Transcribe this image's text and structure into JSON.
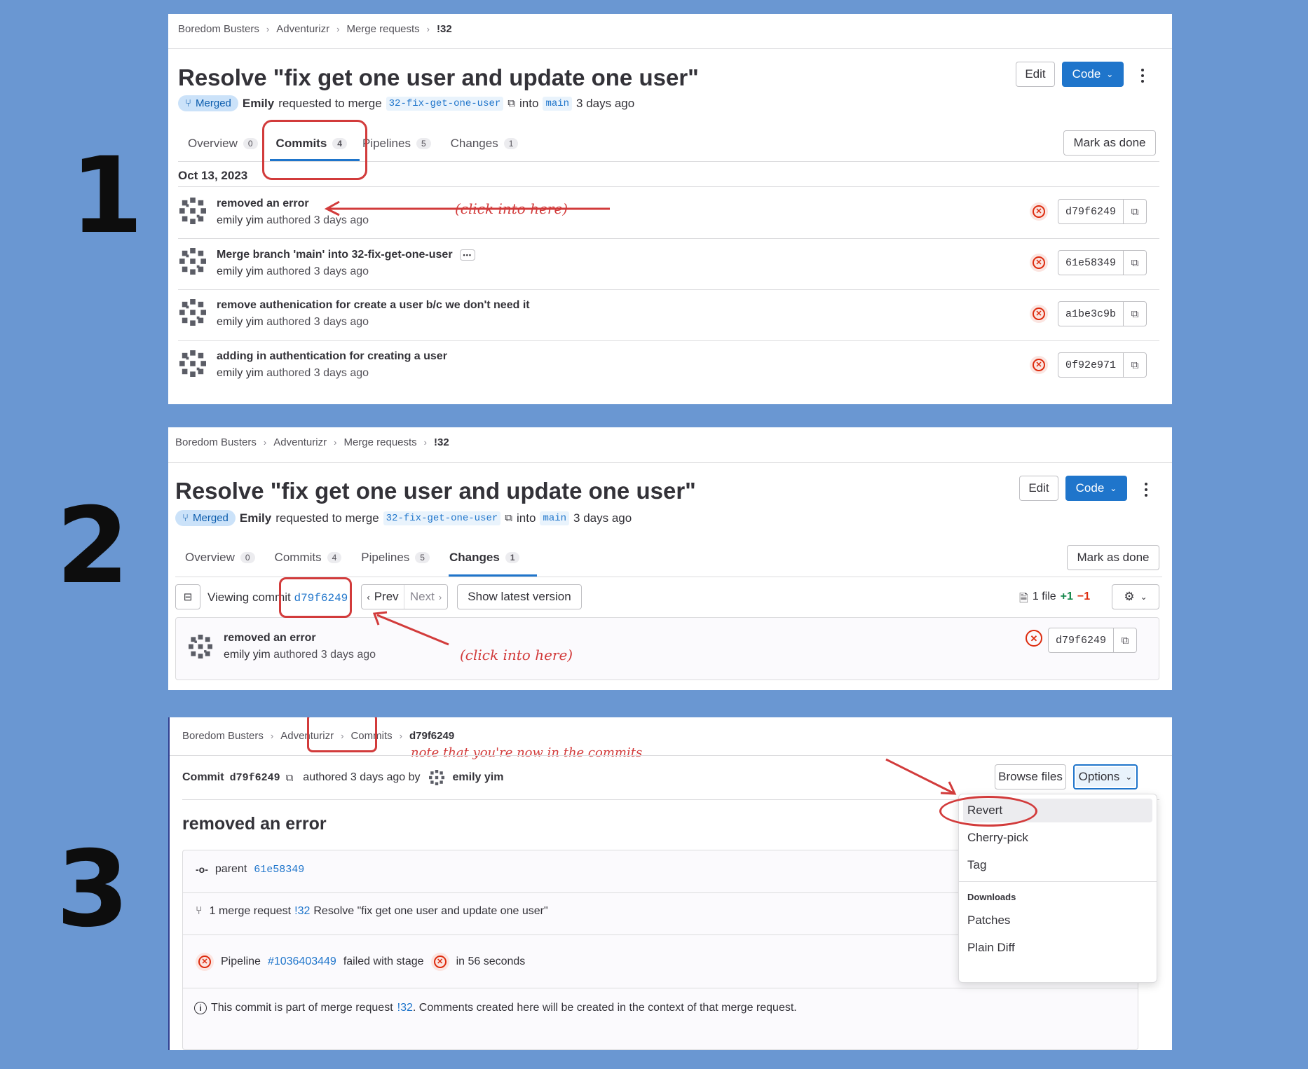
{
  "steps": [
    "1",
    "2",
    "3"
  ],
  "breadcrumb": {
    "group": "Boredom Busters",
    "project": "Adventurizr",
    "section": "Merge requests",
    "mr": "!32"
  },
  "mr": {
    "title": "Resolve \"fix get one user and update one user\"",
    "status": "Merged",
    "author": "Emily",
    "requested_text": "requested to merge",
    "source_branch": "32-fix-get-one-user",
    "into_text": "into",
    "target_branch": "main",
    "time": "3 days ago"
  },
  "buttons": {
    "edit": "Edit",
    "code": "Code",
    "mark_done": "Mark as done"
  },
  "tabs": [
    {
      "label": "Overview",
      "count": "0"
    },
    {
      "label": "Commits",
      "count": "4"
    },
    {
      "label": "Pipelines",
      "count": "5"
    },
    {
      "label": "Changes",
      "count": "1"
    }
  ],
  "commits_date": "Oct 13, 2023",
  "commits": [
    {
      "title": "removed an error",
      "author": "emily yim",
      "meta": "authored 3 days ago",
      "sha": "d79f6249"
    },
    {
      "title": "Merge branch 'main' into 32-fix-get-one-user",
      "author": "emily yim",
      "meta": "authored 3 days ago",
      "sha": "61e58349",
      "ellipsis": "•••"
    },
    {
      "title": "remove authenication for create a user b/c we don't need it",
      "author": "emily yim",
      "meta": "authored 3 days ago",
      "sha": "a1be3c9b"
    },
    {
      "title": "adding in authentication for creating a user",
      "author": "emily yim",
      "meta": "authored 3 days ago",
      "sha": "0f92e971"
    }
  ],
  "annotations": {
    "click_here_1": "(click into here)",
    "click_here_2": "(click into here)",
    "note_commits": "note that you're now in the commits"
  },
  "changes": {
    "viewing_label": "Viewing commit",
    "viewing_sha": "d79f6249",
    "prev": "Prev",
    "next": "Next",
    "show_latest": "Show latest version",
    "file_count": "1 file",
    "additions": "+1",
    "deletions": "−1",
    "commit_title": "removed an error",
    "commit_author": "emily yim",
    "commit_meta": "authored 3 days ago",
    "commit_sha": "d79f6249"
  },
  "commit_page": {
    "breadcrumb_commits": "Commits",
    "breadcrumb_sha": "d79f6249",
    "commit_label": "Commit",
    "sha": "d79f6249",
    "authored": "authored 3 days ago by",
    "author": "emily yim",
    "browse_files": "Browse files",
    "options": "Options",
    "title": "removed an error",
    "parent_label": "parent",
    "parent_sha": "61e58349",
    "mr_count_text": "1 merge request",
    "mr_link": "!32",
    "mr_title": "Resolve \"fix get one user and update one user\"",
    "pipeline_label": "Pipeline",
    "pipeline_id": "#1036403449",
    "pipeline_status": "failed with stage",
    "pipeline_duration": "in 56 seconds",
    "info_prefix": "This commit is part of merge request",
    "info_link": "!32",
    "info_suffix": ". Comments created here will be created in the context of that merge request."
  },
  "options_menu": {
    "items": [
      "Revert",
      "Cherry-pick",
      "Tag"
    ],
    "section_header": "Downloads",
    "downloads": [
      "Patches",
      "Plain Diff"
    ]
  },
  "colors": {
    "background": "#6a97d2",
    "accent": "#1f75cb",
    "annotation": "#d23b3b",
    "merged_badge": "#cbe2f9",
    "failed": "#dd2b0e"
  }
}
